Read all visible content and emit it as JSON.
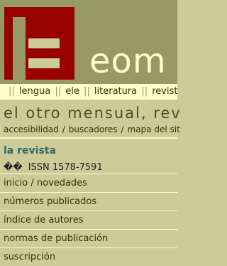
{
  "brand": "eom",
  "topnav": [
    "lengua",
    "ele",
    "literatura",
    "revista e"
  ],
  "tagline": "el otro mensual, rev",
  "utilnav": [
    "accesibilidad",
    "buscadores",
    "mapa del sit"
  ],
  "section_title": "la revista",
  "issn_glyphs": "��",
  "issn": "ISSN 1578-7591",
  "menu": [
    "inicio / novedades",
    "números publicados",
    "índice de autores",
    "normas de publicación",
    "suscripción"
  ],
  "colors": {
    "background": "#cccc99",
    "header": "#999966",
    "logo_red": "#990000",
    "brand_text": "#ffffcc",
    "section_title": "#336666"
  }
}
